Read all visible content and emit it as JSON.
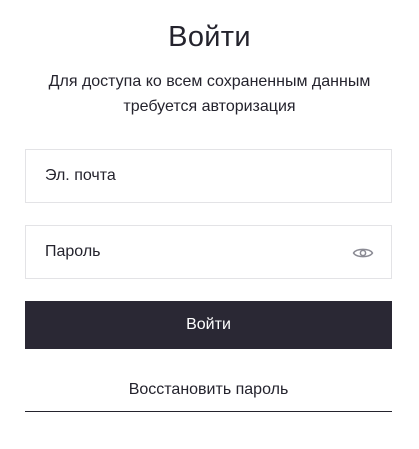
{
  "login": {
    "title": "Войти",
    "subtitle": "Для доступа ко всем сохраненным данным требуется авторизация",
    "email": {
      "placeholder": "Эл. почта",
      "value": ""
    },
    "password": {
      "placeholder": "Пароль",
      "value": "",
      "toggle_icon": "eye-icon"
    },
    "submit_label": "Войти",
    "restore_label": "Восстановить пароль"
  },
  "colors": {
    "text": "#24232d",
    "button_bg": "#2a2834",
    "button_text": "#ffffff",
    "field_border": "#e3e3e6",
    "icon": "#8a8a93"
  }
}
